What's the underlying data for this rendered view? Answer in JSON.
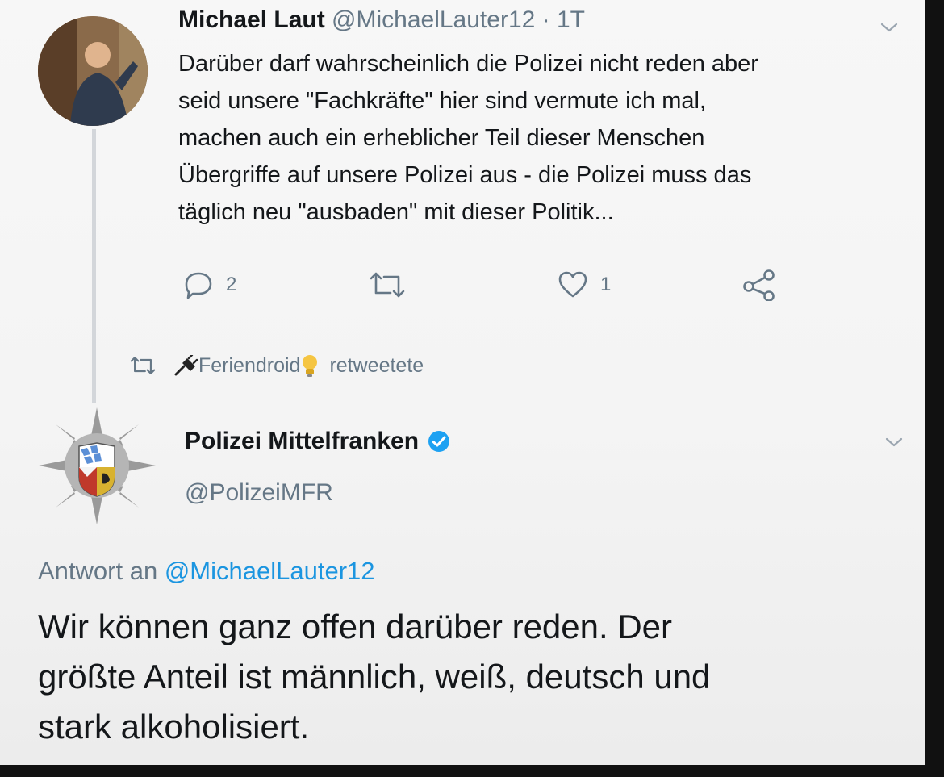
{
  "tweet_1": {
    "author_name": "Michael Laut",
    "handle": "@MichaelLauter12",
    "separator": "·",
    "time": "1T",
    "text": "Darüber darf wahrscheinlich die Polizei nicht reden aber\nseid unsere \"Fachkräfte\" hier sind vermute ich mal,\nmachen auch ein erheblicher Teil dieser Menschen\nÜbergriffe auf unsere Polizei aus    - die Polizei muss das\ntäglich neu \"ausbaden\" mit dieser Politik...",
    "actions": {
      "reply_icon": "reply-icon",
      "reply_count": "2",
      "retweet_icon": "retweet-icon",
      "like_icon": "heart-icon",
      "like_count": "1",
      "share_icon": "share-icon"
    }
  },
  "retweet_context": {
    "icon": "retweet-icon",
    "retweeter_name": "Feriendroid",
    "retweeter_emojis": [
      "plug-icon",
      "lightbulb-icon"
    ],
    "suffix": "retweetete"
  },
  "tweet_2": {
    "author_name": "Polizei Mittelfranken",
    "verified_icon": "verified-badge-icon",
    "handle": "@PolizeiMFR",
    "reply_prefix": "Antwort an",
    "reply_mention": "@MichaelLauter12",
    "text": "Wir können ganz offen darüber reden. Der\ngrößte Anteil ist männlich, weiß, deutsch und\nstark alkoholisiert."
  },
  "colors": {
    "text_primary": "#14171a",
    "text_secondary": "#657786",
    "link": "#1b95e0",
    "verified": "#1da1f2"
  }
}
